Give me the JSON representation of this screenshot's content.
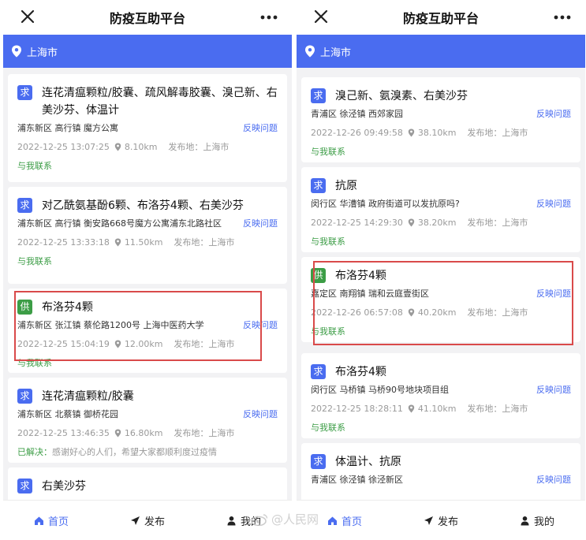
{
  "app_title": "防疫互助平台",
  "location": "上海市",
  "report_label": "反映问题",
  "contact_label": "与我联系",
  "pub_prefix": "发布地：",
  "tabs": {
    "home": "首页",
    "publish": "发布",
    "mine": "我的"
  },
  "watermark": "@人民网",
  "colors": {
    "accent": "#4a6cf0",
    "need_tag": "#4a6cf0",
    "offer_tag": "#3c9d46",
    "contact": "#3c9d46",
    "highlight": "#d94a4a"
  },
  "left": {
    "cards": [
      {
        "tag": "求",
        "title": "连花清瘟颗粒/胶囊、疏风解毒胶囊、溴己新、右美沙芬、体温计",
        "address": "浦东新区 高行镇 魔方公寓",
        "time": "2022-12-25 13:07:25",
        "distance": "8.10km",
        "pub_place": "上海市"
      },
      {
        "tag": "求",
        "title": "对乙酰氨基酚6颗、布洛芬4颗、右美沙芬",
        "address": "浦东新区 高行镇 衡安路668号魔方公寓浦东北路社区",
        "time": "2022-12-25 13:33:18",
        "distance": "11.50km",
        "pub_place": "上海市"
      },
      {
        "tag": "供",
        "title": "布洛芬4颗",
        "address": "浦东新区 张江镇 蔡伦路1200号 上海中医药大学",
        "time": "2022-12-25 15:04:19",
        "distance": "12.00km",
        "pub_place": "上海市"
      },
      {
        "tag": "求",
        "title": "连花清瘟颗粒/胶囊",
        "address": "浦东新区 北蔡镇 御桥花园",
        "time": "2022-12-25 13:46:35",
        "distance": "16.80km",
        "pub_place": "上海市",
        "solved_label": "已解决：",
        "solved_text": "感谢好心的人们，希望大家都顺利度过疫情"
      },
      {
        "tag": "求",
        "title": "右美沙芬"
      }
    ]
  },
  "right": {
    "cards": [
      {
        "tag": "求",
        "title": "溴己新、氨溴素、右美沙芬",
        "address": "青浦区 徐泾镇 西郊家园",
        "time": "2022-12-26 09:49:58",
        "distance": "38.10km",
        "pub_place": "上海市"
      },
      {
        "tag": "求",
        "title": "抗原",
        "address": "闵行区 华漕镇 政府街道可以发抗原吗?",
        "time": "2022-12-25 14:29:30",
        "distance": "38.20km",
        "pub_place": "上海市"
      },
      {
        "tag": "供",
        "title": "布洛芬4颗",
        "address": "嘉定区 南翔镇 瑞和云庭壹街区",
        "time": "2022-12-26 06:57:08",
        "distance": "40.20km",
        "pub_place": "上海市"
      },
      {
        "tag": "求",
        "title": "布洛芬4颗",
        "address": "闵行区 马桥镇 马桥90号地块项目组",
        "time": "2022-12-25 18:28:11",
        "distance": "41.10km",
        "pub_place": "上海市"
      },
      {
        "tag": "求",
        "title": "体温计、抗原",
        "address": "青浦区 徐泾镇 徐泾新区"
      }
    ]
  }
}
